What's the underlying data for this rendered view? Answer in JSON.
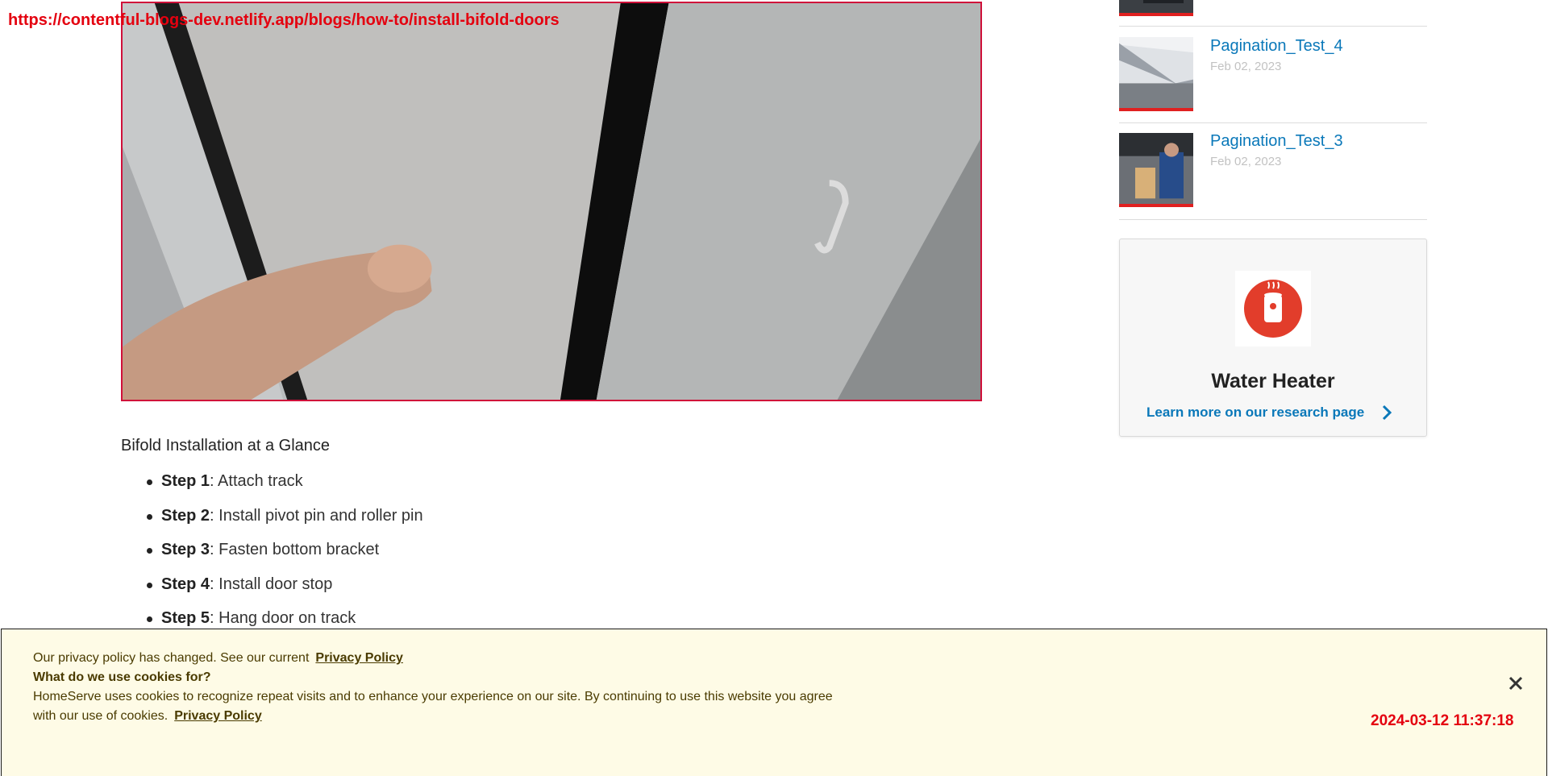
{
  "browser": {
    "url": "https://contentful-blogs-dev.netlify.app/blogs/how-to/install-bifold-doors"
  },
  "article": {
    "hero_image_alt": "Hand installing pivot pin on a bifold door",
    "glance_title": "Bifold Installation at a Glance",
    "steps": [
      {
        "label": "Step 1",
        "text": ": Attach track"
      },
      {
        "label": "Step 2",
        "text": ": Install pivot pin and roller pin"
      },
      {
        "label": "Step 3",
        "text": ": Fasten bottom bracket"
      },
      {
        "label": "Step 4",
        "text": ": Install door stop"
      },
      {
        "label": "Step 5",
        "text": ": Hang door on track"
      }
    ]
  },
  "sidebar": {
    "posts": [
      {
        "title": "Pagination_Test_4",
        "date": "Feb 02, 2023"
      },
      {
        "title": "Pagination_Test_3",
        "date": "Feb 02, 2023"
      }
    ],
    "card": {
      "icon": "water-heater-icon",
      "title": "Water Heater",
      "link_label": "Learn more on our research page"
    }
  },
  "cookie_banner": {
    "line1": "Our privacy policy has changed. See our current",
    "privacy_link_1": "Privacy Policy",
    "heading": "What do we use cookies for?",
    "body": "HomeServe uses cookies to recognize repeat visits and to enhance your experience on our site. By continuing to use this website you agree with our use of cookies.",
    "privacy_link_2": "Privacy Policy",
    "close_icon": "close-icon"
  },
  "overlay_timestamp": "2024-03-12 11:37:18",
  "colors": {
    "link": "#0a78b9",
    "accent_red": "#e02020",
    "cookie_bg": "#fefbe6",
    "cookie_text": "#4a3b00",
    "overlay_red": "#e4000f"
  }
}
